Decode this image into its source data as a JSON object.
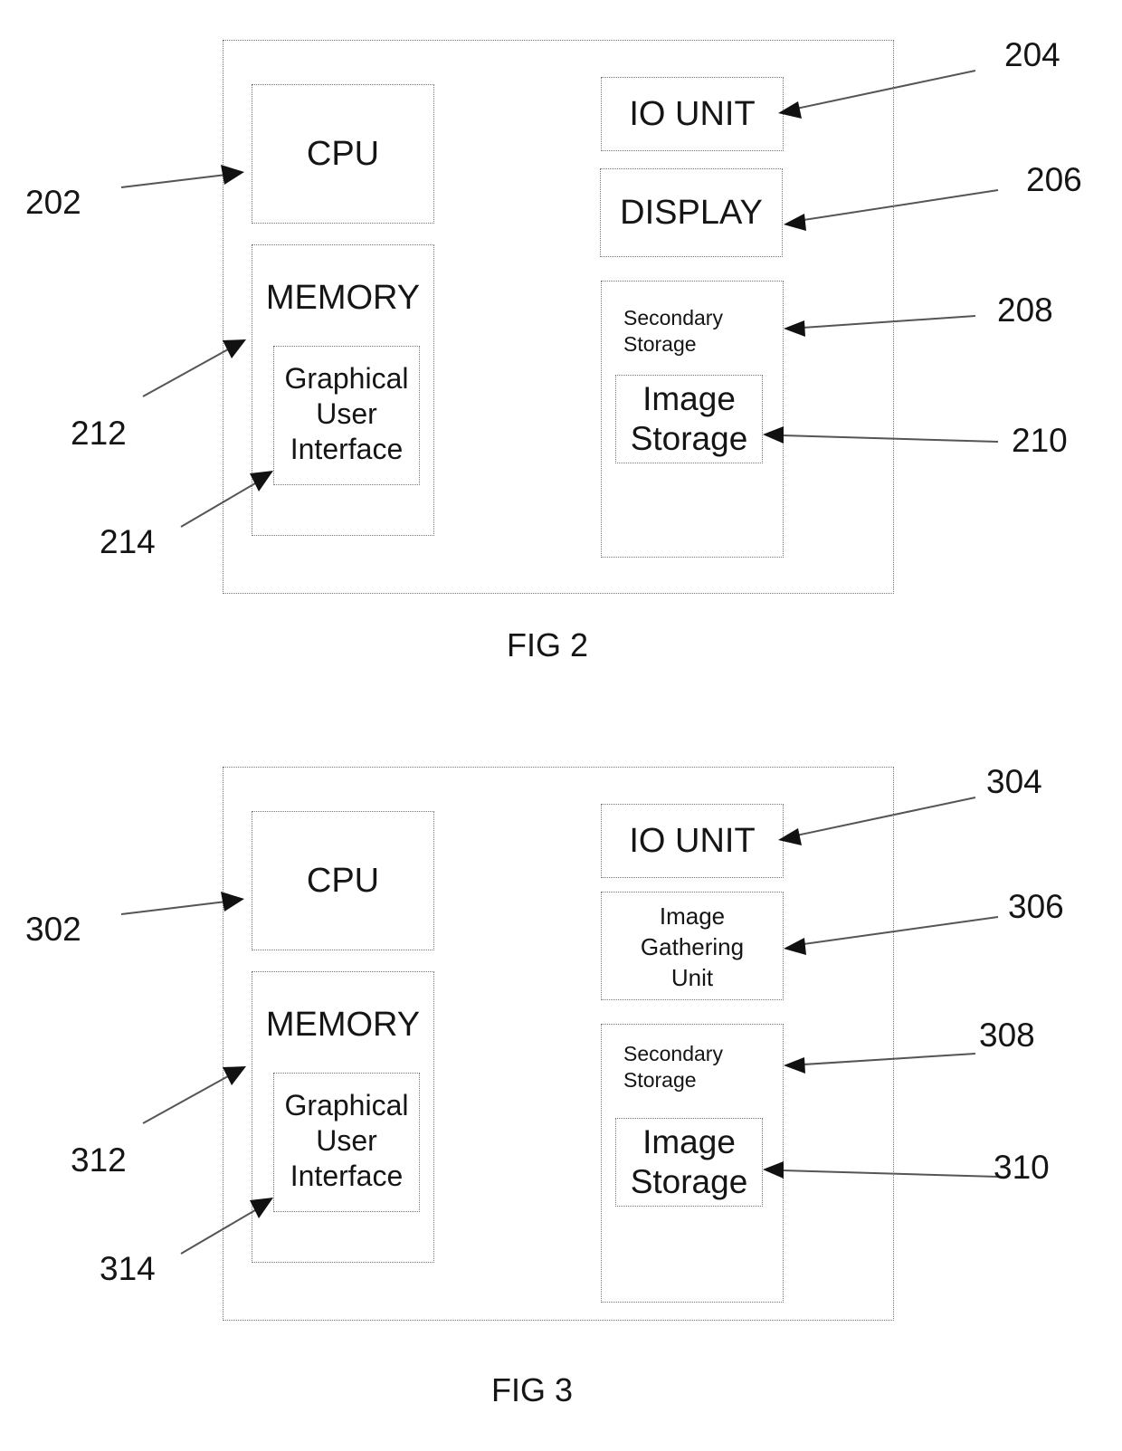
{
  "figures": [
    {
      "caption": "FIG 2",
      "outer_ref": "",
      "cpu": {
        "label": "CPU",
        "ref": "202"
      },
      "memory": {
        "label": "MEMORY",
        "ref": "212"
      },
      "gui": {
        "line1": "Graphical",
        "line2": "User",
        "line3": "Interface",
        "ref": "214"
      },
      "io": {
        "label": "IO UNIT",
        "ref": "204"
      },
      "middle": {
        "line1": "DISPLAY",
        "line2": "",
        "line3": "",
        "ref": "206"
      },
      "secondary": {
        "line1": "Secondary",
        "line2": "Storage",
        "ref": "208"
      },
      "image_storage": {
        "line1": "Image",
        "line2": "Storage",
        "ref": "210"
      }
    },
    {
      "caption": "FIG 3",
      "outer_ref": "",
      "cpu": {
        "label": "CPU",
        "ref": "302"
      },
      "memory": {
        "label": "MEMORY",
        "ref": "312"
      },
      "gui": {
        "line1": "Graphical",
        "line2": "User",
        "line3": "Interface",
        "ref": "314"
      },
      "io": {
        "label": "IO UNIT",
        "ref": "304"
      },
      "middle": {
        "line1": "Image",
        "line2": "Gathering",
        "line3": "Unit",
        "ref": "306"
      },
      "secondary": {
        "line1": "Secondary",
        "line2": "Storage",
        "ref": "308"
      },
      "image_storage": {
        "line1": "Image",
        "line2": "Storage",
        "ref": "310"
      }
    }
  ]
}
